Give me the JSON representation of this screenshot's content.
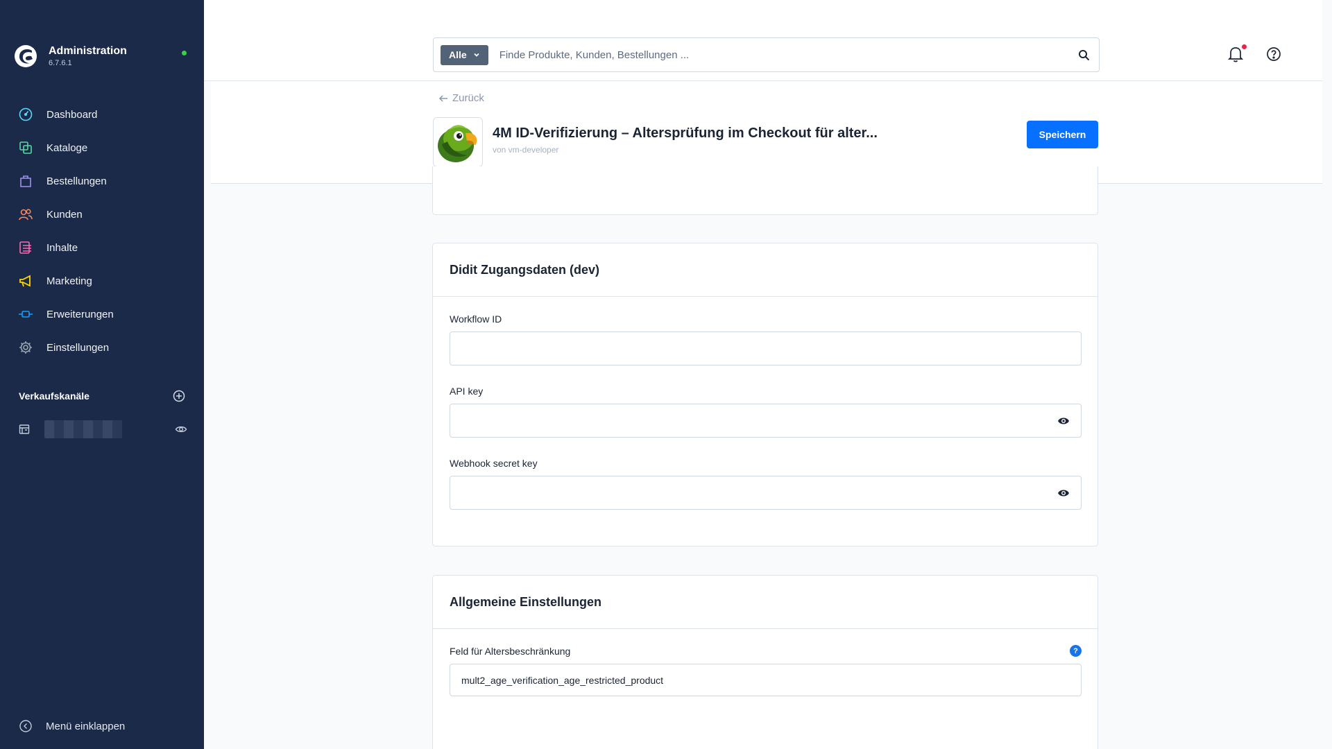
{
  "sidebar": {
    "brand_title": "Administration",
    "brand_version": "6.7.6.1",
    "items": [
      {
        "label": "Dashboard",
        "icon": "dashboard-icon",
        "color": "#57d9ff"
      },
      {
        "label": "Kataloge",
        "icon": "catalogue-icon",
        "color": "#57d9a3"
      },
      {
        "label": "Bestellungen",
        "icon": "orders-bag-icon",
        "color": "#a092f0"
      },
      {
        "label": "Kunden",
        "icon": "customers-icon",
        "color": "#f88962"
      },
      {
        "label": "Inhalte",
        "icon": "content-icon",
        "color": "#ff68b4"
      },
      {
        "label": "Marketing",
        "icon": "marketing-megaphone-icon",
        "color": "#ffd700"
      },
      {
        "label": "Erweiterungen",
        "icon": "extensions-plug-icon",
        "color": "#189eff"
      },
      {
        "label": "Einstellungen",
        "icon": "settings-gear-icon",
        "color": "#9aa8b5"
      }
    ],
    "channels_title": "Verkaufskanäle",
    "collapse_label": "Menü einklappen"
  },
  "search": {
    "type_label": "Alle",
    "placeholder": "Finde Produkte, Kunden, Bestellungen ..."
  },
  "header": {
    "back_label": "Zurück",
    "app_title": "4M ID-Verifizierung – Altersprüfung im Checkout für alter...",
    "vendor": "von vm-developer",
    "save_label": "Speichern"
  },
  "didit_card": {
    "title": "Didit Zugangsdaten (dev)",
    "fields": [
      {
        "label": "Workflow ID",
        "value": ""
      },
      {
        "label": "API key",
        "value": ""
      },
      {
        "label": "Webhook secret key",
        "value": ""
      }
    ]
  },
  "general_card": {
    "title": "Allgemeine Einstellungen",
    "field_label": "Feld für Altersbeschränkung",
    "field_value": "mult2_age_verification_age_restricted_product",
    "help_glyph": "?"
  },
  "colors": {
    "sidebar_bg": "#1b2a48",
    "primary": "#0870ff",
    "online_dot": "#37d046",
    "notification_dot": "#de294c"
  }
}
